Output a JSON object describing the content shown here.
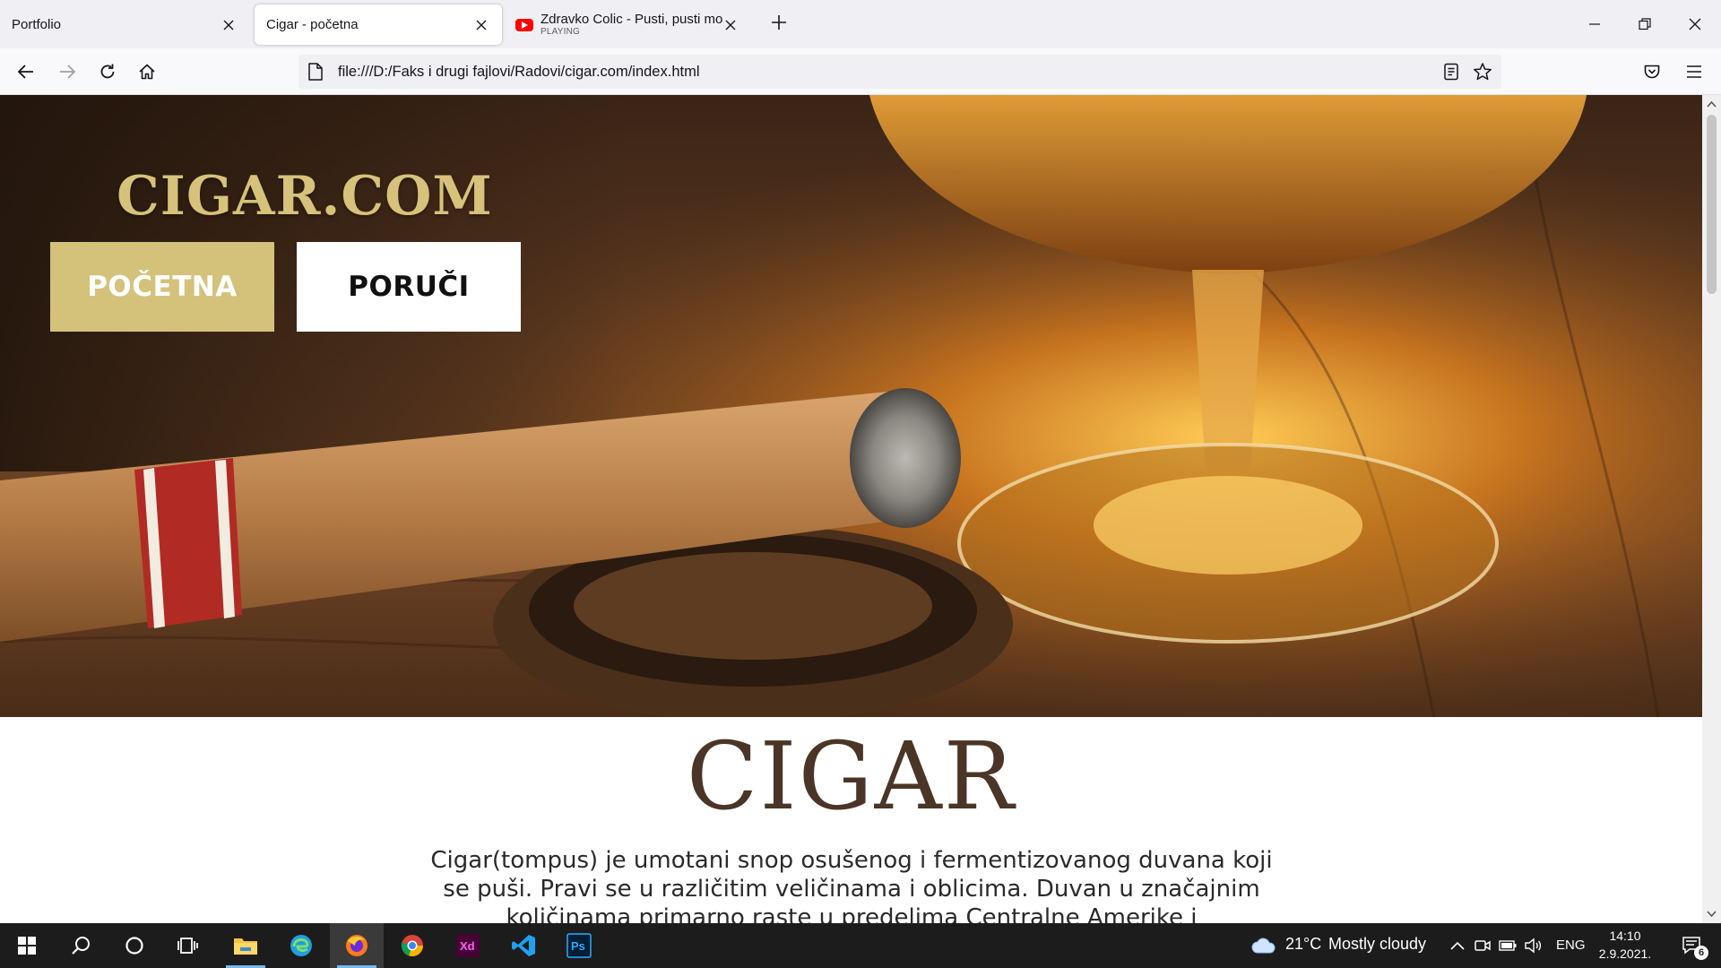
{
  "browser": {
    "tabs": [
      {
        "title": "Portfolio",
        "active": false
      },
      {
        "title": "Cigar - početna",
        "active": true
      },
      {
        "title": "Zdravko Colic - Pusti, pusti modu",
        "subtitle": "PLAYING",
        "active": false
      }
    ],
    "url": "file:///D:/Faks i drugi fajlovi/Radovi/cigar.com/index.html"
  },
  "page": {
    "logo": "CIGAR.COM",
    "nav": {
      "home_label": "POČETNA",
      "order_label": "PORUČI"
    },
    "title": "CIGAR",
    "paragraph": "Cigar(tompus) je umotani snop osušenog i fermentizovanog duvana koji se puši. Pravi se u različitim veličinama i oblicima. Duvan u značajnim količinama primarno raste u predelima Centralne Amerike i"
  },
  "taskbar": {
    "weather": {
      "temp": "21°C",
      "condition": "Mostly cloudy"
    },
    "language": "ENG",
    "time": "14:10",
    "date": "2.9.2021.",
    "notification_count": "6",
    "apps": [
      "start-icon",
      "search-icon",
      "cortana-icon",
      "task-view-icon",
      "file-explorer-icon",
      "edge-icon",
      "firefox-icon",
      "chrome-icon",
      "adobe-xd-icon",
      "vscode-icon",
      "photoshop-icon"
    ]
  },
  "colors": {
    "accent_gold": "#d4c27b",
    "title_brown": "#4a3526",
    "taskbar": "#1c1c1c"
  }
}
